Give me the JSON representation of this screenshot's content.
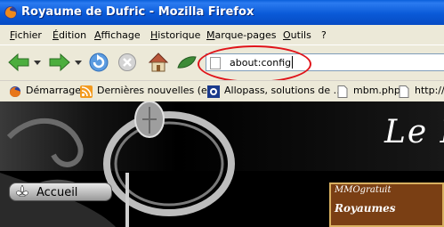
{
  "window": {
    "title": "Royaume de Dufric - Mozilla Firefox"
  },
  "menu": {
    "items": [
      "Fichier",
      "Édition",
      "Affichage",
      "Historique",
      "Marque-pages",
      "Outils",
      "?"
    ]
  },
  "navigation": {
    "back_icon": "back-arrow-icon",
    "forward_icon": "forward-arrow-icon",
    "reload_icon": "reload-icon",
    "stop_icon": "stop-icon",
    "home_icon": "home-icon",
    "address_value": "about:config"
  },
  "bookmarks": [
    {
      "label": "Démarrage",
      "icon": "firefox-icon"
    },
    {
      "label": "Dernières nouvelles (e...",
      "icon": "rss-icon"
    },
    {
      "label": "Allopass, solutions de ...",
      "icon": "allopass-icon"
    },
    {
      "label": "mbm.php",
      "icon": "page-icon"
    },
    {
      "label": "http://",
      "icon": "page-icon"
    }
  ],
  "page": {
    "heading": "Le R",
    "nav_button": "Accueil",
    "promo_top": "MMOgratuit",
    "promo_main": "Royaumes"
  },
  "colors": {
    "titlebar": "#0a5ad8",
    "annotation": "#e0141a",
    "page_bg": "#000000"
  }
}
